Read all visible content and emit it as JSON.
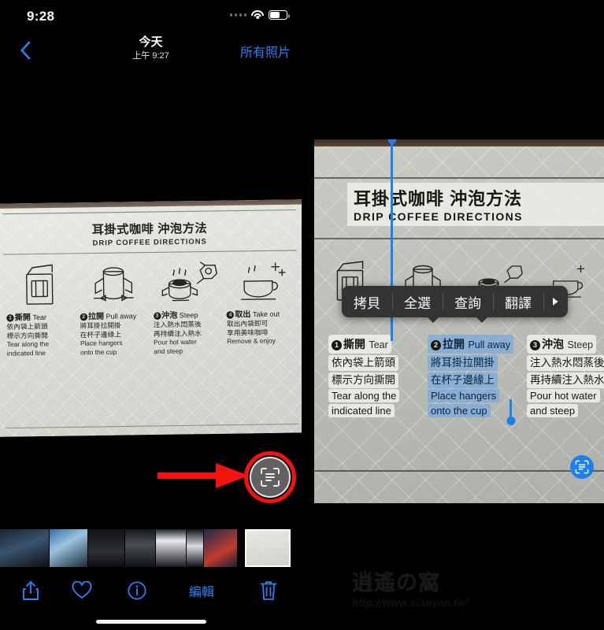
{
  "left": {
    "status": {
      "time": "9:28",
      "wifi_icon": "wifi-icon",
      "battery_icon": "battery-icon",
      "signal_icon": "signal-dots-icon"
    },
    "nav": {
      "back_icon": "chevron-left-icon",
      "title": "今天",
      "subtitle": "上午 9:27",
      "action": "所有照片"
    },
    "scan_button": {
      "icon": "live-text-scan-icon"
    },
    "annotation": {
      "arrow_icon": "red-arrow-right-icon",
      "highlight_color": "#f5130f"
    },
    "toolbar": {
      "share_icon": "share-icon",
      "favorite_icon": "heart-icon",
      "info_icon": "info-circle-icon",
      "edit_label": "編輯",
      "delete_icon": "trash-icon",
      "accent_color": "#2f7ff0"
    },
    "thumbnails": [
      {
        "name": "thumb-1"
      },
      {
        "name": "thumb-2"
      },
      {
        "name": "thumb-3"
      },
      {
        "name": "thumb-4"
      },
      {
        "name": "thumb-5"
      },
      {
        "name": "thumb-6"
      },
      {
        "name": "thumb-7-selected",
        "selected": true
      }
    ]
  },
  "photo_content": {
    "title_zh": "耳掛式咖啡 沖泡方法",
    "title_en": "DRIP COFFEE DIRECTIONS",
    "steps": [
      {
        "num": "❶",
        "number": "1",
        "head_zh": "撕開",
        "head_en": "Tear",
        "zh_lines": [
          "依內袋上箭頭",
          "標示方向撕開"
        ],
        "en_lines": [
          "Tear along the",
          "indicated line"
        ],
        "art_icon": "coffee-sachet-icon"
      },
      {
        "num": "❷",
        "number": "2",
        "head_zh": "拉開",
        "head_en": "Pull away",
        "zh_lines": [
          "將耳掛拉開掛",
          "在杯子邊緣上"
        ],
        "en_lines": [
          "Place hangers",
          "onto the cup"
        ],
        "art_icon": "pull-hangers-icon"
      },
      {
        "num": "❸",
        "number": "3",
        "head_zh": "沖泡",
        "head_en": "Steep",
        "zh_lines": [
          "注入熱水悶蒸後",
          "再持續注入熱水"
        ],
        "en_lines": [
          "Pour hot water",
          "and steep"
        ],
        "art_icon": "kettle-pour-icon"
      },
      {
        "num": "❹",
        "number": "4",
        "head_zh": "取出",
        "head_en": "Take out",
        "zh_lines": [
          "取出內袋即可",
          "享用美味咖啡"
        ],
        "en_lines": [
          "Remove & enjoy"
        ],
        "art_icon": "coffee-cup-sparkle-icon"
      }
    ]
  },
  "right": {
    "context_menu": {
      "items": [
        "拷貝",
        "全選",
        "查詢",
        "翻譯"
      ],
      "more_icon": "chevron-right-icon"
    },
    "selection": {
      "selected_step_index": 1,
      "handle_icon": "selection-handle-icon",
      "highlight_color": "#6aa6e6"
    },
    "scan_button": {
      "icon": "live-text-scan-icon",
      "active_color": "#1c7ff2"
    },
    "watermark": {
      "mark": "逍遙の窩",
      "url": "http://www.xiaoyao.tw/"
    }
  }
}
